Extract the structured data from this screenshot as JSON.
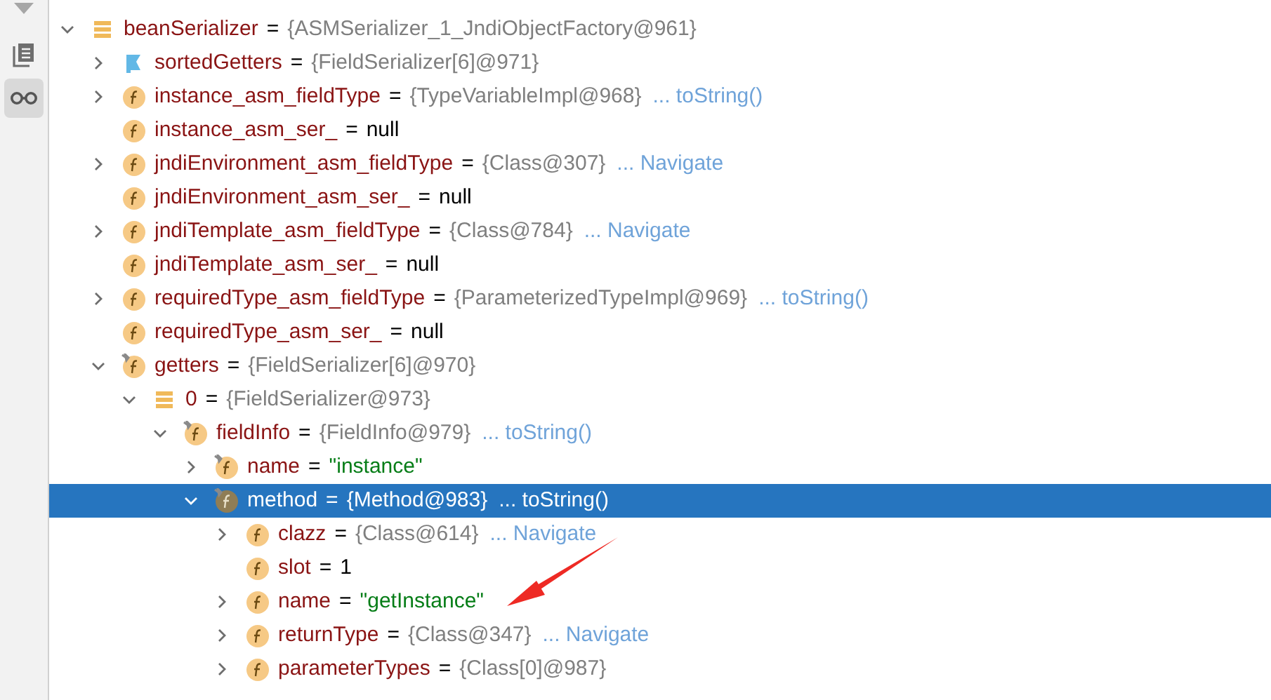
{
  "tree": [
    {
      "name": "beanSerializer",
      "sign": "=",
      "object": "{ASMSerializer_1_JndiObjectFactory@961}",
      "kind": "list",
      "expandable": true,
      "expanded": true,
      "selected": false,
      "children": [
        {
          "name": "sortedGetters",
          "sign": "=",
          "object": "{FieldSerializer[6]@971}",
          "kind": "flag",
          "expandable": true,
          "expanded": false,
          "selected": false
        },
        {
          "name": "instance_asm_fieldType",
          "sign": "=",
          "object": "{TypeVariableImpl@968}",
          "link": "... toString()",
          "kind": "field",
          "expandable": true,
          "expanded": false,
          "selected": false
        },
        {
          "name": "instance_asm_ser_",
          "sign": "=",
          "value": "null",
          "kind": "field",
          "expandable": false,
          "selected": false
        },
        {
          "name": "jndiEnvironment_asm_fieldType",
          "sign": "=",
          "object": "{Class@307}",
          "link": "... Navigate",
          "kind": "field",
          "expandable": true,
          "expanded": false,
          "selected": false
        },
        {
          "name": "jndiEnvironment_asm_ser_",
          "sign": "=",
          "value": "null",
          "kind": "field",
          "expandable": false,
          "selected": false
        },
        {
          "name": "jndiTemplate_asm_fieldType",
          "sign": "=",
          "object": "{Class@784}",
          "link": "... Navigate",
          "kind": "field",
          "expandable": true,
          "expanded": false,
          "selected": false
        },
        {
          "name": "jndiTemplate_asm_ser_",
          "sign": "=",
          "value": "null",
          "kind": "field",
          "expandable": false,
          "selected": false
        },
        {
          "name": "requiredType_asm_fieldType",
          "sign": "=",
          "object": "{ParameterizedTypeImpl@969}",
          "link": "... toString()",
          "kind": "field",
          "expandable": true,
          "expanded": false,
          "selected": false
        },
        {
          "name": "requiredType_asm_ser_",
          "sign": "=",
          "value": "null",
          "kind": "field",
          "expandable": false,
          "selected": false
        },
        {
          "name": "getters",
          "sign": "=",
          "object": "{FieldSerializer[6]@970}",
          "kind": "pinned-field",
          "expandable": true,
          "expanded": true,
          "selected": false,
          "children": [
            {
              "name": "0",
              "sign": "=",
              "object": "{FieldSerializer@973}",
              "kind": "list",
              "expandable": true,
              "expanded": true,
              "selected": false,
              "children": [
                {
                  "name": "fieldInfo",
                  "sign": "=",
                  "object": "{FieldInfo@979}",
                  "link": "... toString()",
                  "kind": "pinned-field",
                  "expandable": true,
                  "expanded": true,
                  "selected": false,
                  "children": [
                    {
                      "name": "name",
                      "sign": "=",
                      "string": "\"instance\"",
                      "kind": "pinned-field",
                      "expandable": true,
                      "expanded": false,
                      "selected": false
                    },
                    {
                      "name": "method",
                      "sign": "=",
                      "object": "{Method@983}",
                      "link": "... toString()",
                      "kind": "pinned-field",
                      "expandable": true,
                      "expanded": true,
                      "selected": true,
                      "children": [
                        {
                          "name": "clazz",
                          "sign": "=",
                          "object": "{Class@614}",
                          "link": "... Navigate",
                          "kind": "field",
                          "expandable": true,
                          "expanded": false,
                          "selected": false
                        },
                        {
                          "name": "slot",
                          "sign": "=",
                          "value": "1",
                          "kind": "field",
                          "expandable": false,
                          "selected": false
                        },
                        {
                          "name": "name",
                          "sign": "=",
                          "string": "\"getInstance\"",
                          "kind": "field",
                          "expandable": true,
                          "expanded": false,
                          "selected": false
                        },
                        {
                          "name": "returnType",
                          "sign": "=",
                          "object": "{Class@347}",
                          "link": "... Navigate",
                          "kind": "field",
                          "expandable": true,
                          "expanded": false,
                          "selected": false
                        },
                        {
                          "name": "parameterTypes",
                          "sign": "=",
                          "object": "{Class[0]@987}",
                          "kind": "field",
                          "expandable": true,
                          "expanded": false,
                          "selected": false
                        }
                      ]
                    }
                  ]
                }
              ]
            }
          ]
        }
      ]
    }
  ]
}
